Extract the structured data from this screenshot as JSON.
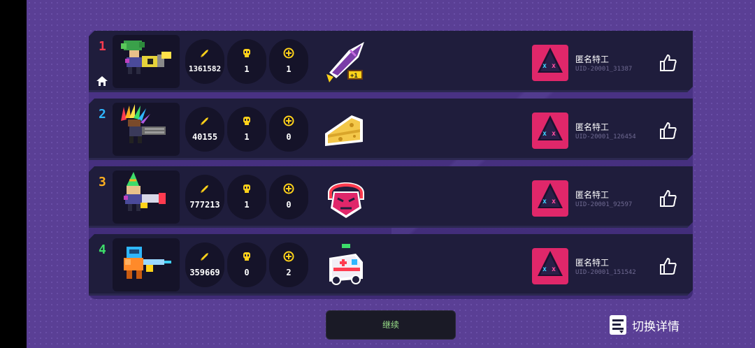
{
  "players": [
    {
      "rank": "1",
      "rank_color": "#ff3b4f",
      "is_self": true,
      "character": "tree-hair-knight-with-nuke-gun",
      "coins": "1361582",
      "kills": "1",
      "revives": "1",
      "item": "rocket-plus-one-icon",
      "name": "匿名特工",
      "uid": "UID-20001_31387"
    },
    {
      "rank": "2",
      "rank_color": "#2fb7ff",
      "is_self": false,
      "character": "feather-headdress-knight-with-minigun",
      "coins": "40155",
      "kills": "1",
      "revives": "0",
      "item": "cheese-icon",
      "name": "匿名特工",
      "uid": "UID-20001_126454"
    },
    {
      "rank": "3",
      "rank_color": "#ffb020",
      "is_self": false,
      "character": "party-hat-knight-with-cannon",
      "coins": "777213",
      "kills": "1",
      "revives": "0",
      "item": "demon-mask-icon",
      "name": "匿名特工",
      "uid": "UID-20001_92597"
    },
    {
      "rank": "4",
      "rank_color": "#3ddc6a",
      "is_self": false,
      "character": "orange-robot-with-laser-gun",
      "coins": "359669",
      "kills": "0",
      "revives": "2",
      "item": "ambulance-icon",
      "name": "匿名特工",
      "uid": "UID-20001_151542"
    }
  ],
  "icons": {
    "coin": "bullet-coin-icon",
    "kills": "skull-icon",
    "revives": "plus-circle-icon",
    "like": "thumbs-up-icon",
    "home": "home-icon",
    "switch": "document-switch-icon"
  },
  "colors": {
    "background": "#5a3f95",
    "row": "#1f1d3c",
    "coin_yellow": "#ffd21a",
    "avatar_pink": "#e0276a"
  },
  "footer": {
    "continue_label": "继续",
    "switch_label": "切换详情"
  }
}
